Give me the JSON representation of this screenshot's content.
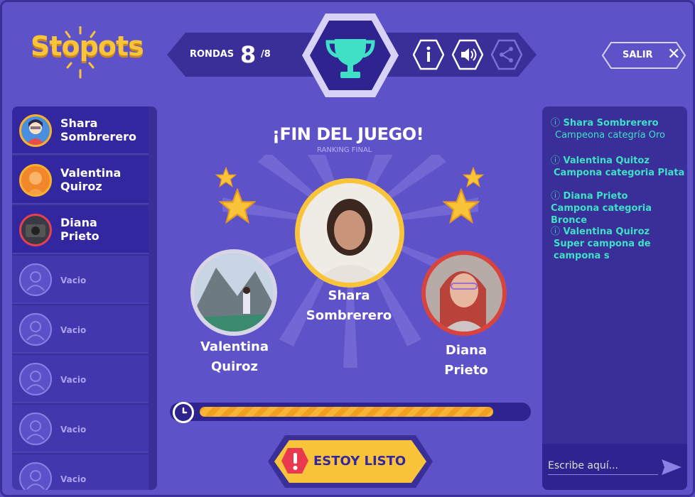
{
  "header": {
    "logo": "Stopots",
    "rounds_label": "RONDAS",
    "rounds_current": "8",
    "rounds_total": "/8",
    "exit_label": "SALIR",
    "buttons": [
      "info-icon",
      "speaker-icon",
      "share-icon"
    ]
  },
  "players": [
    {
      "name": "Shara\nSombrerero",
      "avatar_border": "#f9b12c"
    },
    {
      "name": "Valentina\nQuiroz",
      "avatar_border": "#f9b12c"
    },
    {
      "name": "Diana\nPrieto",
      "avatar_border": "#e34050"
    },
    {
      "name": "Vacio"
    },
    {
      "name": "Vacio"
    },
    {
      "name": "Vacio"
    },
    {
      "name": "Vacio"
    },
    {
      "name": "Vacio"
    }
  ],
  "stage": {
    "title": "¡FIN DEL JUEGO!",
    "subtitle": "RANKING FINAL",
    "first": "Shara\nSombrerero",
    "second": "Valentina\nQuiroz",
    "third": "Diana\nPrieto",
    "timer_progress": 0.93,
    "ready_label": "ESTOY LISTO"
  },
  "chat": {
    "messages": [
      {
        "name": "Shara  Sombrerero",
        "text": "Campeona categría Oro"
      },
      {
        "name": " Valentina Quitoz",
        "text": "Campona categoria Plata"
      },
      {
        "name": "Diana Prieto",
        "text": "Campona categoria Bronce"
      },
      {
        "name": " Valentina Quiroz",
        "text": "Super campona de\ncampona s"
      }
    ],
    "placeholder": "Escribe aquí..."
  },
  "colors": {
    "background": "#5e52c9",
    "panel": "#3a2f99",
    "gold": "#f9c43a",
    "accent_teal": "#3fe0c5",
    "silver": "#c9c9d6",
    "bronze": "#d8433e"
  }
}
